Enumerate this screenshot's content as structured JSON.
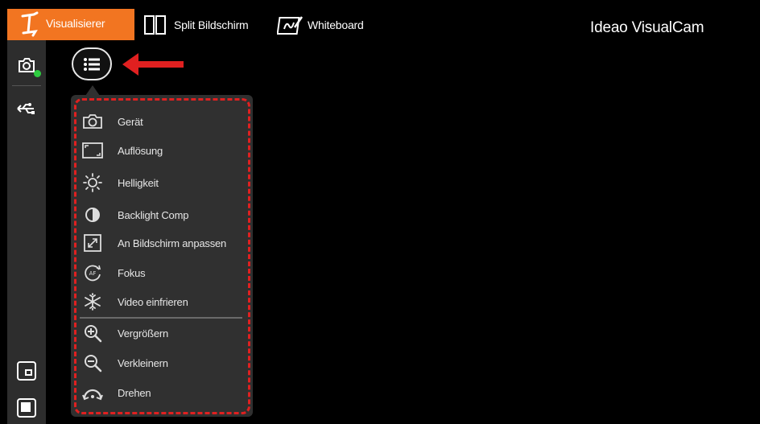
{
  "topbar": {
    "tabs": [
      {
        "label": "Visualisierer",
        "icon": "visualizer-logo-icon",
        "active": true
      },
      {
        "label": "Split Bildschirm",
        "icon": "split-screen-icon",
        "active": false
      },
      {
        "label": "Whiteboard",
        "icon": "whiteboard-icon",
        "active": false
      }
    ],
    "brand": "Ideao VisualCam"
  },
  "colors": {
    "accent": "#f27521",
    "sidebar_bg": "#2d2d2d",
    "menu_bg": "#303030",
    "highlight": "#e02020",
    "status_ok": "#2ecc40"
  },
  "sidebar": {
    "items": [
      {
        "icon": "camera-icon",
        "status": "connected"
      },
      {
        "icon": "usb-icon"
      },
      {
        "icon": "window-mode-icon"
      },
      {
        "icon": "fullscreen-icon"
      }
    ]
  },
  "menu": {
    "toggle_icon": "list-menu-icon",
    "items": [
      {
        "label": "Gerät",
        "icon": "camera-icon"
      },
      {
        "label": "Auflösung",
        "icon": "resolution-icon"
      },
      {
        "label": "Helligkeit",
        "icon": "brightness-icon"
      },
      {
        "label": "Backlight Comp",
        "icon": "contrast-icon"
      },
      {
        "label": "An Bildschirm anpassen",
        "icon": "fit-screen-icon"
      },
      {
        "label": "Fokus",
        "icon": "autofocus-icon"
      },
      {
        "label": "Video einfrieren",
        "icon": "snowflake-icon"
      },
      {
        "label": "Vergrößern",
        "icon": "zoom-in-icon"
      },
      {
        "label": "Verkleinern",
        "icon": "zoom-out-icon"
      },
      {
        "label": "Drehen",
        "icon": "rotate-icon"
      }
    ]
  }
}
